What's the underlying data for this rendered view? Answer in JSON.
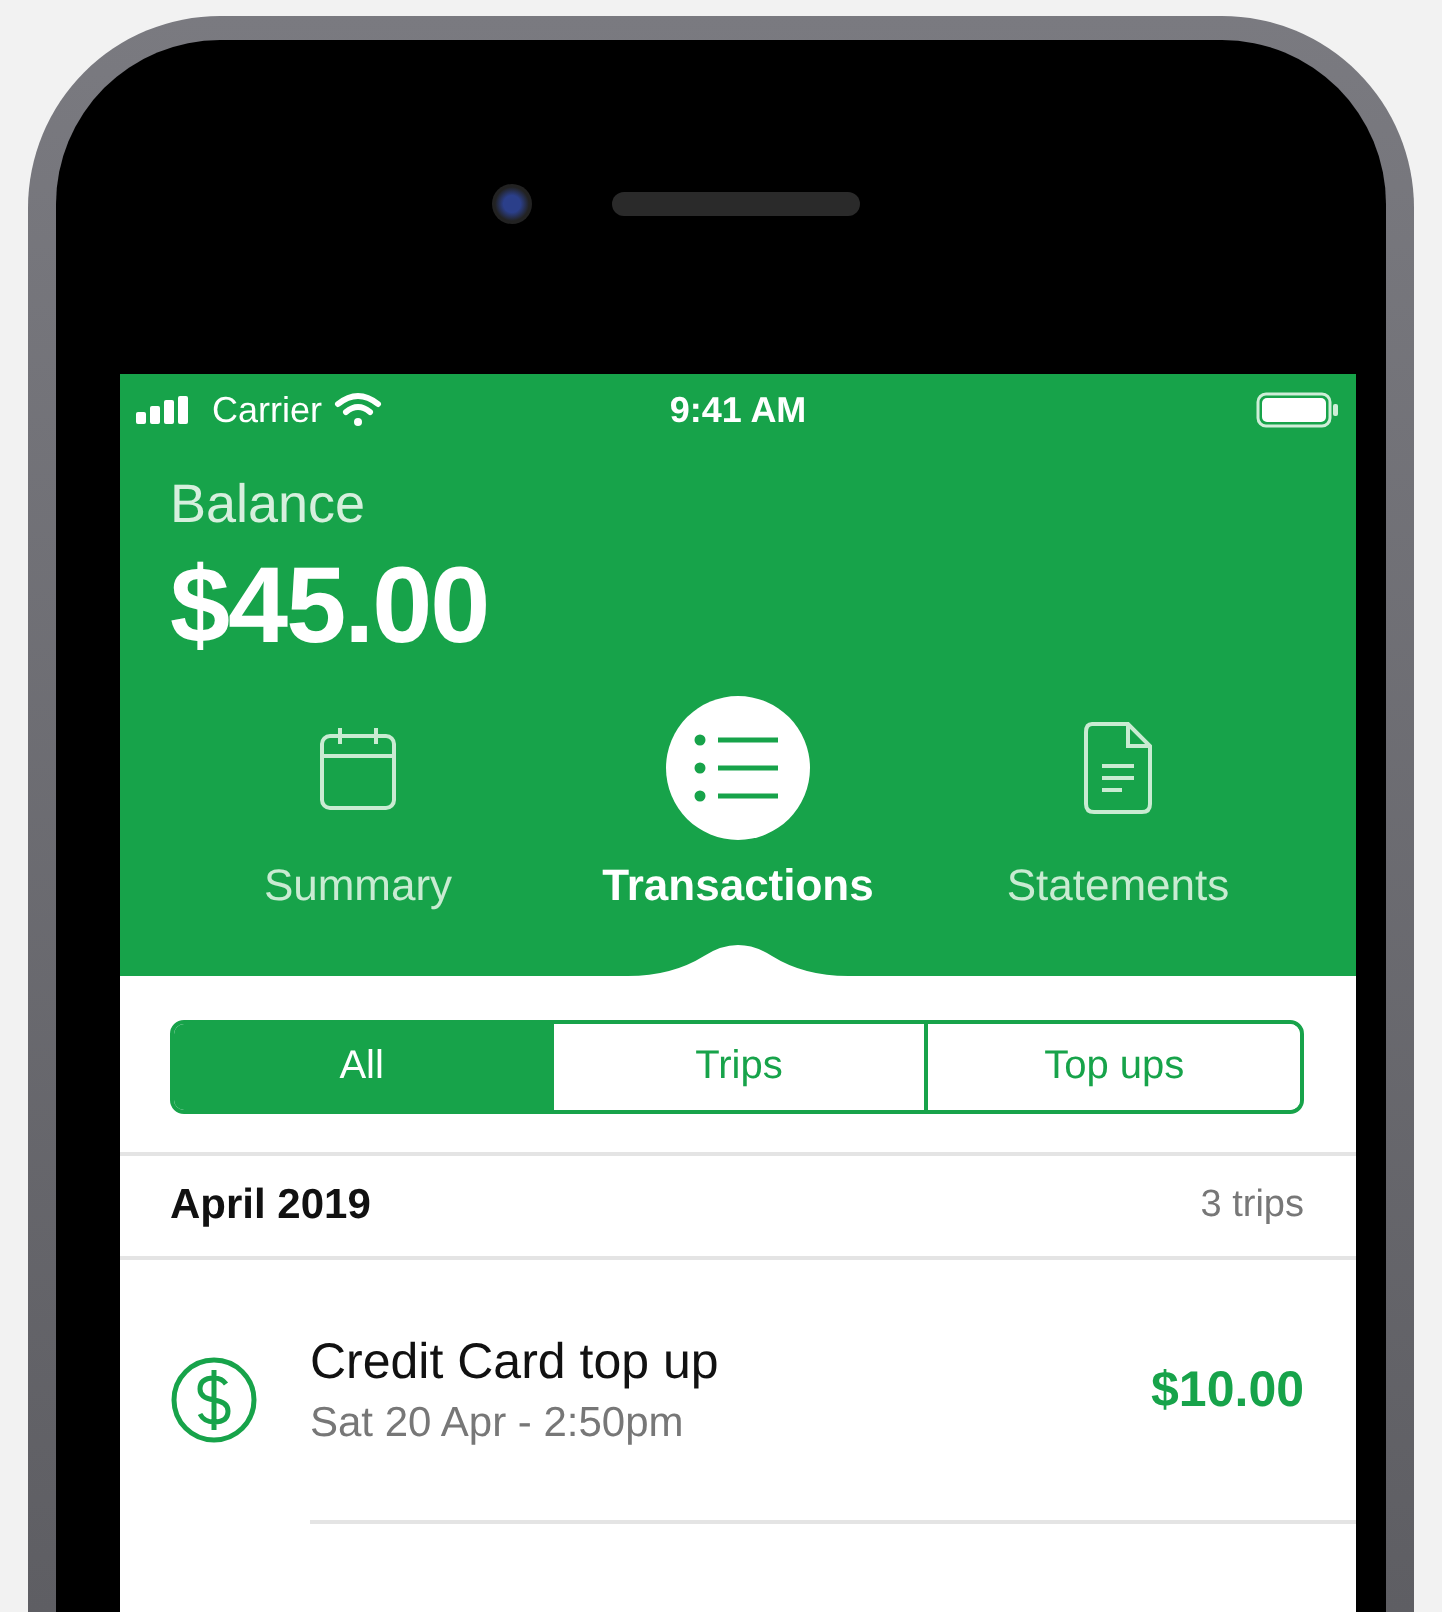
{
  "status_bar": {
    "carrier": "Carrier",
    "time": "9:41 AM"
  },
  "balance": {
    "label": "Balance",
    "amount": "$45.00"
  },
  "tabs": [
    {
      "label": "Summary",
      "selected": false
    },
    {
      "label": "Transactions",
      "selected": true
    },
    {
      "label": "Statements",
      "selected": false
    }
  ],
  "filters": [
    {
      "label": "All",
      "selected": true
    },
    {
      "label": "Trips",
      "selected": false
    },
    {
      "label": "Top ups",
      "selected": false
    }
  ],
  "section": {
    "title": "April 2019",
    "count": "3 trips"
  },
  "transactions": [
    {
      "title": "Credit Card top up",
      "subtitle": "Sat 20 Apr - 2:50pm",
      "amount": "$10.00"
    }
  ]
}
